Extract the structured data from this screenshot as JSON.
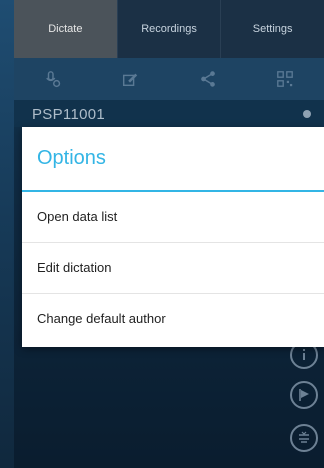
{
  "tabs": [
    {
      "label": "Dictate",
      "active": true
    },
    {
      "label": "Recordings",
      "active": false
    },
    {
      "label": "Settings",
      "active": false
    }
  ],
  "toolbar": {
    "icons": [
      "record-settings-icon",
      "edit-icon",
      "share-icon",
      "qr-code-icon"
    ]
  },
  "file": {
    "name": "PSP11001"
  },
  "dialog": {
    "title": "Options",
    "options": [
      {
        "label": "Open data list"
      },
      {
        "label": "Edit dictation"
      },
      {
        "label": "Change default author"
      }
    ]
  },
  "side_icons": [
    "info-icon",
    "flag-icon",
    "insert-icon"
  ],
  "colors": {
    "accent": "#33b5e5",
    "tab_active": "#4b535a"
  }
}
